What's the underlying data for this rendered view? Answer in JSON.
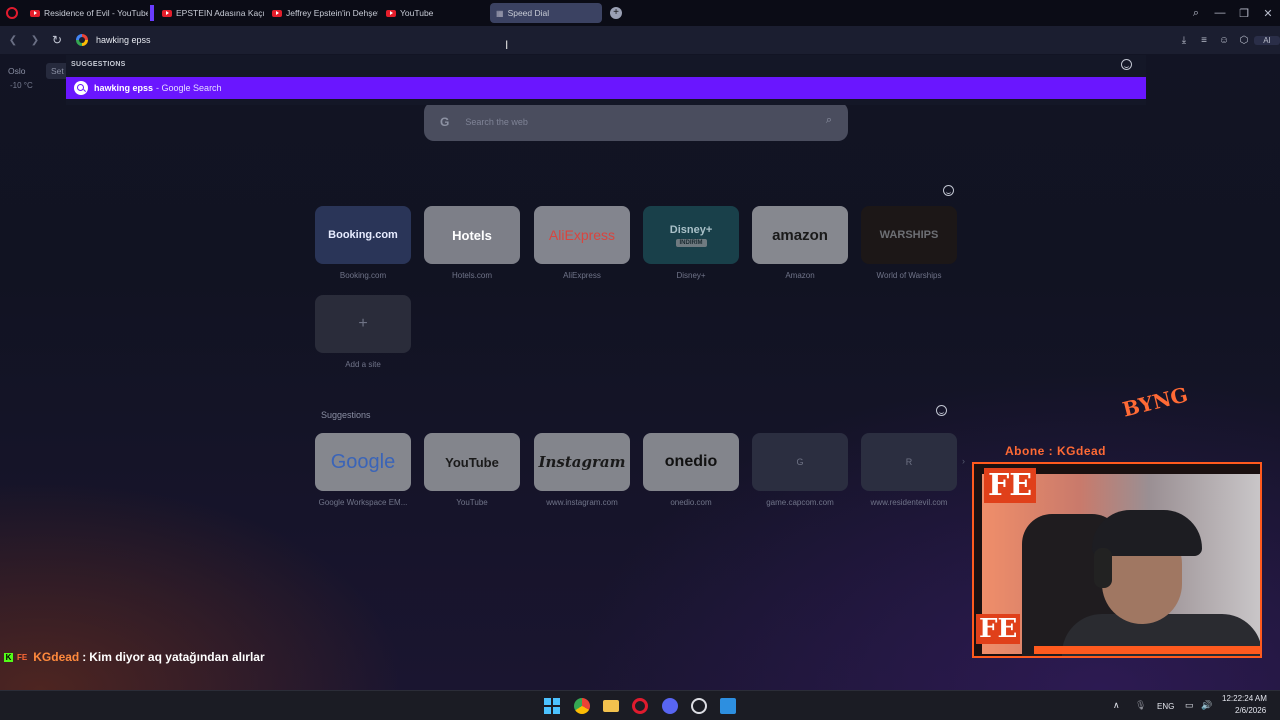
{
  "tabs": [
    {
      "title": "Residence of Evil - YouTube"
    },
    {
      "title": "EPSTEIN Adasına Kaçırılan"
    },
    {
      "title": "Jeffrey Epstein'in Dehşet V"
    },
    {
      "title": "YouTube"
    },
    {
      "title": "Speed Dial"
    }
  ],
  "addressbar": {
    "value": "hawking epss"
  },
  "dropdown": {
    "header": "SUGGESTIONS",
    "item_query": "hawking epss",
    "item_suffix": "- Google Search"
  },
  "weather": {
    "city": "Oslo",
    "set_label": "Set",
    "temp": "-10 °C"
  },
  "search": {
    "placeholder": "Search the web"
  },
  "speed_dial": [
    {
      "logo": "Booking.com",
      "label": "Booking.com"
    },
    {
      "logo": "Hotels",
      "label": "Hotels.com"
    },
    {
      "logo": "AliExpress",
      "label": "AliExpress"
    },
    {
      "logo": "Disney+",
      "badge": "İNDİRİM",
      "label": "Disney+"
    },
    {
      "logo": "amazon",
      "label": "Amazon"
    },
    {
      "logo": "WARSHIPS",
      "label": "World of Warships"
    }
  ],
  "add_site": {
    "symbol": "+",
    "label": "Add a site"
  },
  "suggestions_title": "Suggestions",
  "suggestions": [
    {
      "logo": "Google",
      "label": "Google Workspace EM..."
    },
    {
      "logo": "YouTube",
      "label": "YouTube"
    },
    {
      "logo": "Instagram",
      "label": "www.instagram.com"
    },
    {
      "logo": "onedio",
      "label": "onedio.com"
    },
    {
      "logo": "G",
      "label": "game.capcom.com"
    },
    {
      "logo": "R",
      "label": "www.residentevil.com"
    }
  ],
  "overlay": {
    "abone": "Abone : KGdead",
    "scribble": "BYNG",
    "chat_user": "KGdead",
    "chat_text": "Kim diyor aq yatağından alırlar"
  },
  "taskbar": {
    "lang": "ENG",
    "time": "12:22:24 AM",
    "date": "2/6/2026"
  },
  "colors": {
    "accent": "#6a16ff",
    "stream_orange": "#ff5a1e"
  }
}
